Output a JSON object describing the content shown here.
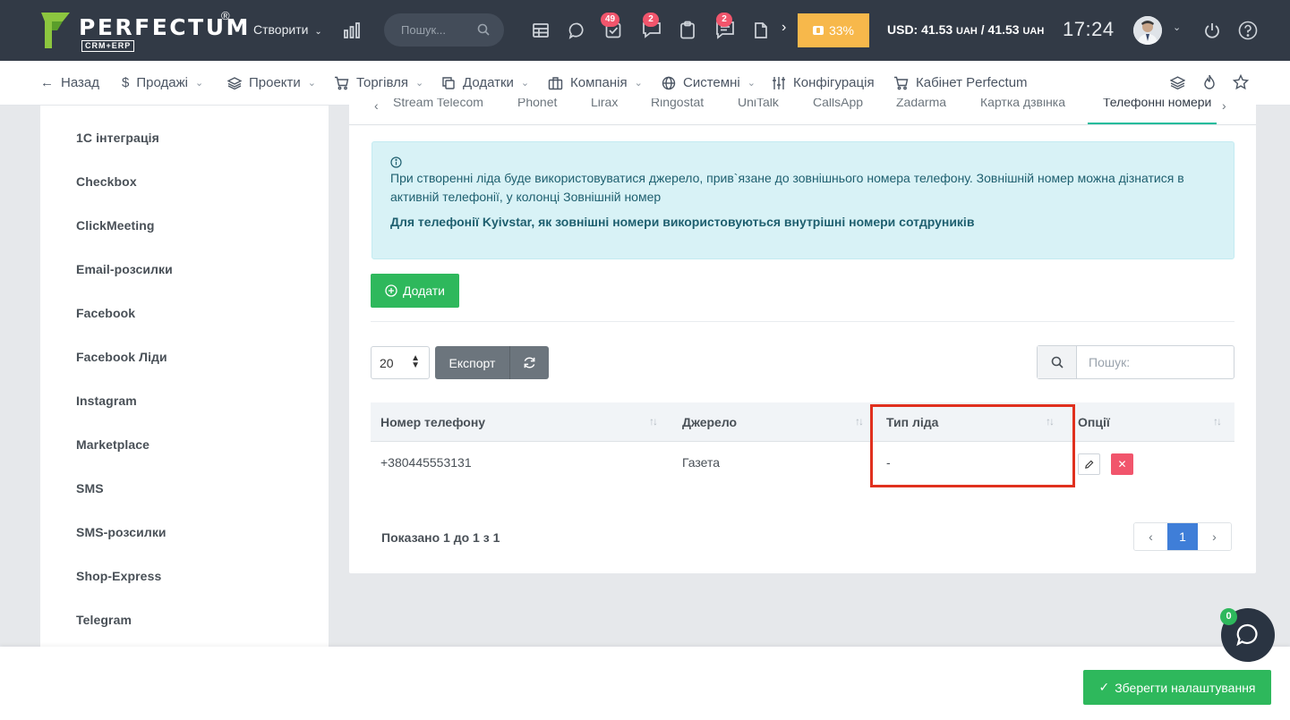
{
  "topbar": {
    "logo_text": "PERFECTUM",
    "logo_reg": "®",
    "logo_sub": "CRM+ERP",
    "create_label": "Створити",
    "search_placeholder": "Пошук...",
    "badges": {
      "tasks": "49",
      "chat": "2",
      "notes": "2"
    },
    "progress_label": "33%",
    "rate_usd": "USD: 41.53 ",
    "rate_uah1": "UAH",
    "rate_mid": " / 41.53 ",
    "rate_uah2": "UAH",
    "clock": "17:24"
  },
  "menubar": {
    "back": "Назад",
    "items": [
      "Продажі",
      "Проекти",
      "Торгівля",
      "Додатки",
      "Компанія",
      "Системні",
      "Конфігурація",
      "Кабінет Perfectum"
    ]
  },
  "sidebar": {
    "items": [
      "1C інтеграція",
      "Checkbox",
      "ClickMeeting",
      "Email-розсилки",
      "Facebook",
      "Facebook Ліди",
      "Instagram",
      "Marketplace",
      "SMS",
      "SMS-розсилки",
      "Shop-Express",
      "Telegram"
    ]
  },
  "tabs": [
    "Stream Telecom",
    "Phonet",
    "Lirax",
    "Ringostat",
    "UniTalk",
    "CallsApp",
    "Zadarma",
    "Картка дзвінка",
    "Телефонні номери"
  ],
  "alert": {
    "line1": "При створенні ліда буде використовуватися джерело, прив`язане до зовнішнього номера телефону. Зовнішній номер можна дізнатися в активній телефонії, у колонці Зовнішній номер",
    "bold": "Для телефонії Kyivstar, як зовнішні номери використовуються внутрішні номери сотдруників"
  },
  "toolbar": {
    "add_label": "Додати",
    "page_size": "20",
    "export_label": "Експорт",
    "search_placeholder": "Пошук:"
  },
  "table": {
    "headers": [
      "Номер телефону",
      "Джерело",
      "Тип ліда",
      "Опції"
    ],
    "rows": [
      {
        "phone": "+380445553131",
        "source": "Газета",
        "lead_type": "-"
      }
    ]
  },
  "pagination": {
    "showing": "Показано 1 до 1 з 1",
    "current": "1"
  },
  "footer": {
    "save_label": "Зберегти налаштування"
  },
  "chat": {
    "badge": "0"
  },
  "colors": {
    "topbar": "#323a46",
    "success": "#2eb85c",
    "danger": "#f1556c",
    "warning": "#f7b84b",
    "highlight": "#e0301e",
    "primary": "#3f7ed8"
  }
}
